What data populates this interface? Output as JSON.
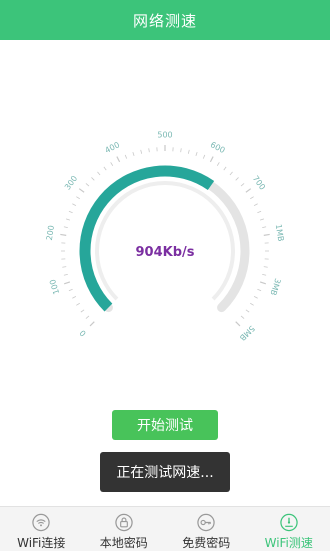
{
  "header": {
    "title": "网络测速"
  },
  "gauge": {
    "speed_text": "904Kb/s",
    "tick_labels": [
      "0",
      "100",
      "200",
      "300",
      "400",
      "500",
      "600",
      "700",
      "1MB",
      "3MB",
      "5MB"
    ],
    "progress_fraction": 0.63,
    "colors": {
      "progress": "#26a69a",
      "track": "#e4e4e4",
      "speed": "#7b2fa1",
      "ticks": "#7ab8b3"
    }
  },
  "actions": {
    "start_label": "开始测试"
  },
  "toast": {
    "text": "正在测试网速..."
  },
  "tabs": [
    {
      "label": "WiFi连接",
      "icon": "wifi-icon",
      "active": false
    },
    {
      "label": "本地密码",
      "icon": "lock-icon",
      "active": false
    },
    {
      "label": "免费密码",
      "icon": "key-icon",
      "active": false
    },
    {
      "label": "WiFi测速",
      "icon": "speedometer-icon",
      "active": true
    }
  ]
}
